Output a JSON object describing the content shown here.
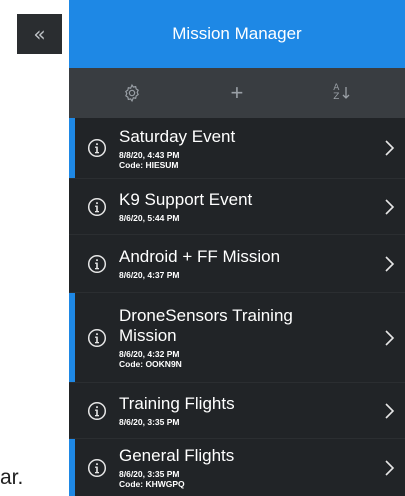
{
  "collapse": {
    "icon": "double-chevron-left-icon",
    "glyph": "«"
  },
  "background_fragment": "ar.",
  "header": {
    "title": "Mission Manager"
  },
  "toolbar": {
    "settings_icon": "gear-icon",
    "add_icon": "plus-icon",
    "add_glyph": "+",
    "sort_icon": "sort-az-icon",
    "sort_a": "A",
    "sort_z": "Z"
  },
  "missions": [
    {
      "title": "Saturday Event",
      "date": "8/8/20, 4:43 PM",
      "code": "Code: HIESUM",
      "active": true
    },
    {
      "title": "K9 Support Event",
      "date": "8/6/20, 5:44 PM",
      "code": "",
      "active": false
    },
    {
      "title": "Android + FF Mission",
      "date": "8/6/20, 4:37 PM",
      "code": "",
      "active": false
    },
    {
      "title": "DroneSensors Training Mission",
      "date": "8/6/20, 4:32 PM",
      "code": "Code: OOKN9N",
      "active": true
    },
    {
      "title": "Training Flights",
      "date": "8/6/20, 3:35 PM",
      "code": "",
      "active": false
    },
    {
      "title": "General Flights",
      "date": "8/6/20, 3:35 PM",
      "code": "Code: KHWGPQ",
      "active": true
    }
  ],
  "colors": {
    "accent": "#1e88e5",
    "panel": "#212427",
    "toolbar": "#393d41"
  }
}
